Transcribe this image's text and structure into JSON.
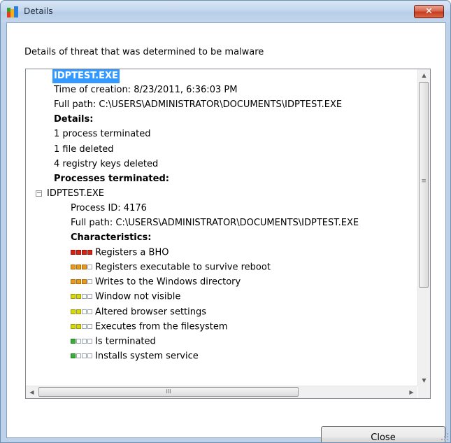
{
  "window": {
    "title": "Details",
    "close_glyph": "✕",
    "accent": "#c63b20"
  },
  "heading": "Details of threat that was determined to be malware",
  "tree": {
    "filename": "IDPTEST.EXE",
    "time_of_creation": "Time of creation: 8/23/2011, 6:36:03 PM",
    "full_path": "Full path: C:\\USERS\\ADMINISTRATOR\\DOCUMENTS\\IDPTEST.EXE",
    "details_header": "Details:",
    "details": [
      "1 process terminated",
      "1 file deleted",
      "4 registry keys deleted"
    ],
    "processes_header": "Processes terminated:",
    "process_name": "IDPTEST.EXE",
    "process_id": "Process ID: 4176",
    "process_path": "Full path: C:\\USERS\\ADMINISTRATOR\\DOCUMENTS\\IDPTEST.EXE",
    "characteristics_header": "Characteristics:",
    "characteristics": [
      {
        "label": "Registers a BHO",
        "level": 4,
        "color": "red"
      },
      {
        "label": "Registers executable to survive reboot",
        "level": 3,
        "color": "orange"
      },
      {
        "label": "Writes to the Windows directory",
        "level": 3,
        "color": "orange"
      },
      {
        "label": "Window not visible",
        "level": 2,
        "color": "yellow"
      },
      {
        "label": "Altered browser settings",
        "level": 2,
        "color": "yellow"
      },
      {
        "label": "Executes from the filesystem",
        "level": 2,
        "color": "yellow"
      },
      {
        "label": "Is terminated",
        "level": 1,
        "color": "green"
      },
      {
        "label": "Installs system service",
        "level": 1,
        "color": "green"
      }
    ]
  },
  "scrollbar": {
    "h_thumb_glyph": "III",
    "up_glyph": "▲",
    "down_glyph": "▼",
    "left_glyph": "◀",
    "right_glyph": "▶",
    "v_grip_glyph": "≡"
  },
  "buttons": {
    "close_label": "Close"
  },
  "icons": {
    "app": "avg-logo-icon",
    "expand": "minus-box-icon"
  }
}
